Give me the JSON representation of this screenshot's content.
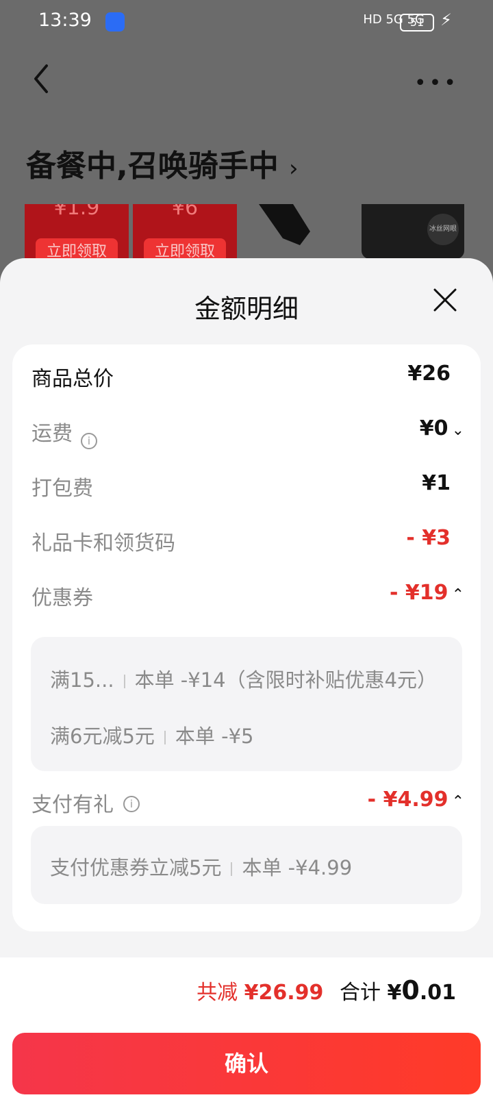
{
  "status_bar": {
    "time": "13:39",
    "signal_text": "HD 5G 5G",
    "battery": "51"
  },
  "header": {
    "order_status": "备餐中,召唤骑手中",
    "more_label": "•••"
  },
  "promo_cards": [
    {
      "price": "¥1.9",
      "button": "立即领取"
    },
    {
      "price": "¥6",
      "button": "立即领取"
    }
  ],
  "promo_thumbs": [
    {
      "label": ""
    },
    {
      "label": "冰丝网眼"
    }
  ],
  "sheet": {
    "title": "金额明细",
    "rows": {
      "goods_total": {
        "label": "商品总价",
        "value": "¥26"
      },
      "shipping": {
        "label": "运费",
        "value": "¥0"
      },
      "packing": {
        "label": "打包费",
        "value": "¥1"
      },
      "giftcard": {
        "label": "礼品卡和领货码",
        "value": "- ¥3"
      },
      "coupon": {
        "label": "优惠券",
        "value": "- ¥19"
      },
      "pay_gift": {
        "label": "支付有礼",
        "value": "- ¥4.99"
      }
    },
    "coupon_details": [
      {
        "name": "满15...",
        "detail": "本单 -¥14（含限时补贴优惠4元）"
      },
      {
        "name": "满6元减5元",
        "detail": "本单 -¥5"
      }
    ],
    "pay_gift_details": [
      {
        "name": "支付优惠券立减5元",
        "detail": "本单 -¥4.99"
      }
    ]
  },
  "footer": {
    "discount_label": "共减",
    "discount_value": "¥26.99",
    "total_label": "合计",
    "total_currency": "¥",
    "total_int": "0",
    "total_dec": ".01",
    "confirm_label": "确认"
  },
  "colors": {
    "accent_red": "#e3302b",
    "button_start": "#f5364a",
    "button_end": "#ff3a28"
  }
}
